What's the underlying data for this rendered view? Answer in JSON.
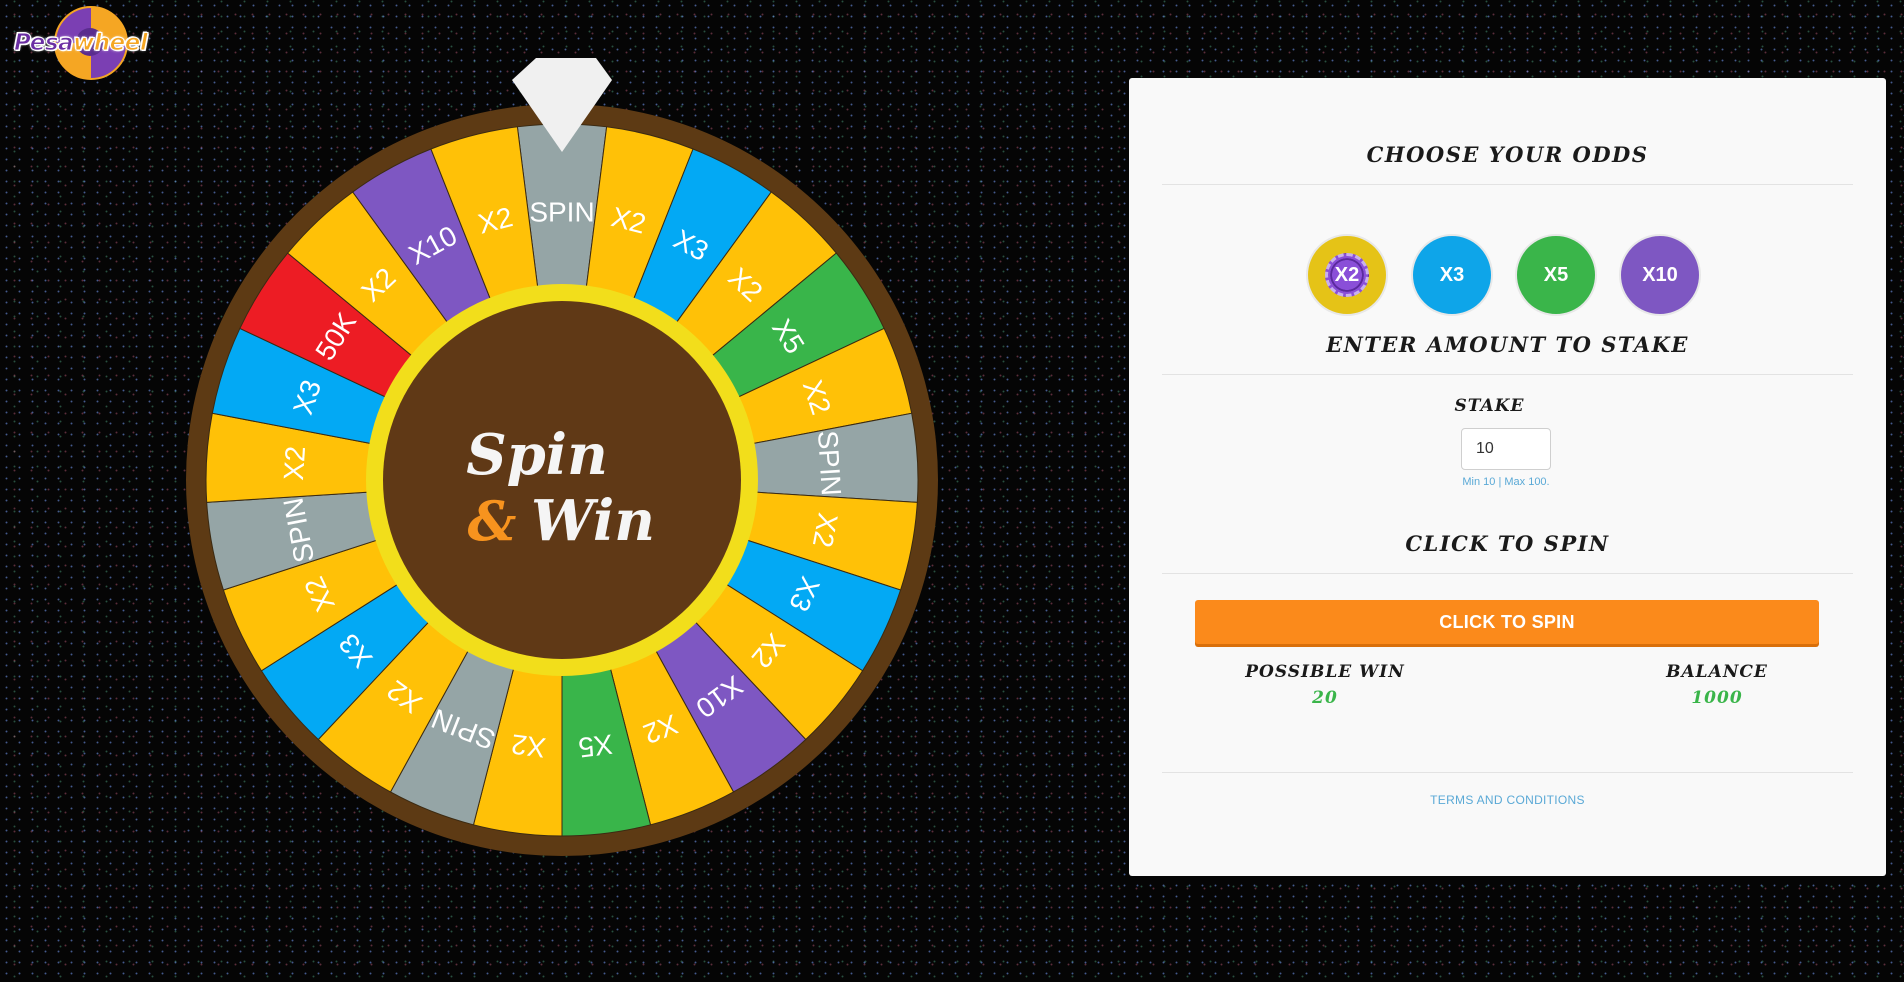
{
  "brand": {
    "name_part1": "Pesa",
    "name_part2": "wheel"
  },
  "wheel": {
    "center_line1": "Spin",
    "center_amp": "&",
    "center_line2": "Win",
    "segments": [
      {
        "label": "SPIN",
        "color": "#95a5a6"
      },
      {
        "label": "X2",
        "color": "#ffc107"
      },
      {
        "label": "X3",
        "color": "#03a9f4"
      },
      {
        "label": "X2",
        "color": "#ffc107"
      },
      {
        "label": "X5",
        "color": "#39b54a"
      },
      {
        "label": "X2",
        "color": "#ffc107"
      },
      {
        "label": "SPIN",
        "color": "#95a5a6"
      },
      {
        "label": "X2",
        "color": "#ffc107"
      },
      {
        "label": "X3",
        "color": "#03a9f4"
      },
      {
        "label": "X2",
        "color": "#ffc107"
      },
      {
        "label": "X10",
        "color": "#7e57c2"
      },
      {
        "label": "X2",
        "color": "#ffc107"
      },
      {
        "label": "X5",
        "color": "#39b54a"
      },
      {
        "label": "X2",
        "color": "#ffc107"
      },
      {
        "label": "SPIN",
        "color": "#95a5a6"
      },
      {
        "label": "X2",
        "color": "#ffc107"
      },
      {
        "label": "X3",
        "color": "#03a9f4"
      },
      {
        "label": "X2",
        "color": "#ffc107"
      },
      {
        "label": "SPIN",
        "color": "#95a5a6"
      },
      {
        "label": "X2",
        "color": "#ffc107"
      },
      {
        "label": "X3",
        "color": "#03a9f4"
      },
      {
        "label": "50K",
        "color": "#ed1c24"
      },
      {
        "label": "X2",
        "color": "#ffc107"
      },
      {
        "label": "X10",
        "color": "#7e57c2"
      },
      {
        "label": "X2",
        "color": "#ffc107"
      }
    ],
    "rim_color": "#5d3a14",
    "inner_ring_color": "#f2de1b",
    "hub_color": "#603916",
    "pointer_color": "#f0f0f0"
  },
  "panel": {
    "choose_odds_title": "CHOOSE YOUR ODDS",
    "odds": [
      {
        "label": "X2",
        "color": "#e5c317",
        "selected": true
      },
      {
        "label": "X3",
        "color": "#0ea5e9",
        "selected": false
      },
      {
        "label": "X5",
        "color": "#3ab54a",
        "selected": false
      },
      {
        "label": "X10",
        "color": "#7e57c2",
        "selected": false
      }
    ],
    "enter_amount_title": "ENTER AMOUNT TO STAKE",
    "stake_label": "STAKE",
    "stake_value": "10",
    "stake_hint": "Min 10 | Max 100.",
    "click_to_spin_title": "CLICK TO SPIN",
    "spin_button_label": "CLICK TO SPIN",
    "possible_win_label": "POSSIBLE WIN",
    "possible_win_value": "20",
    "balance_label": "BALANCE",
    "balance_value": "1000",
    "terms_label": "TERMS AND CONDITIONS"
  }
}
